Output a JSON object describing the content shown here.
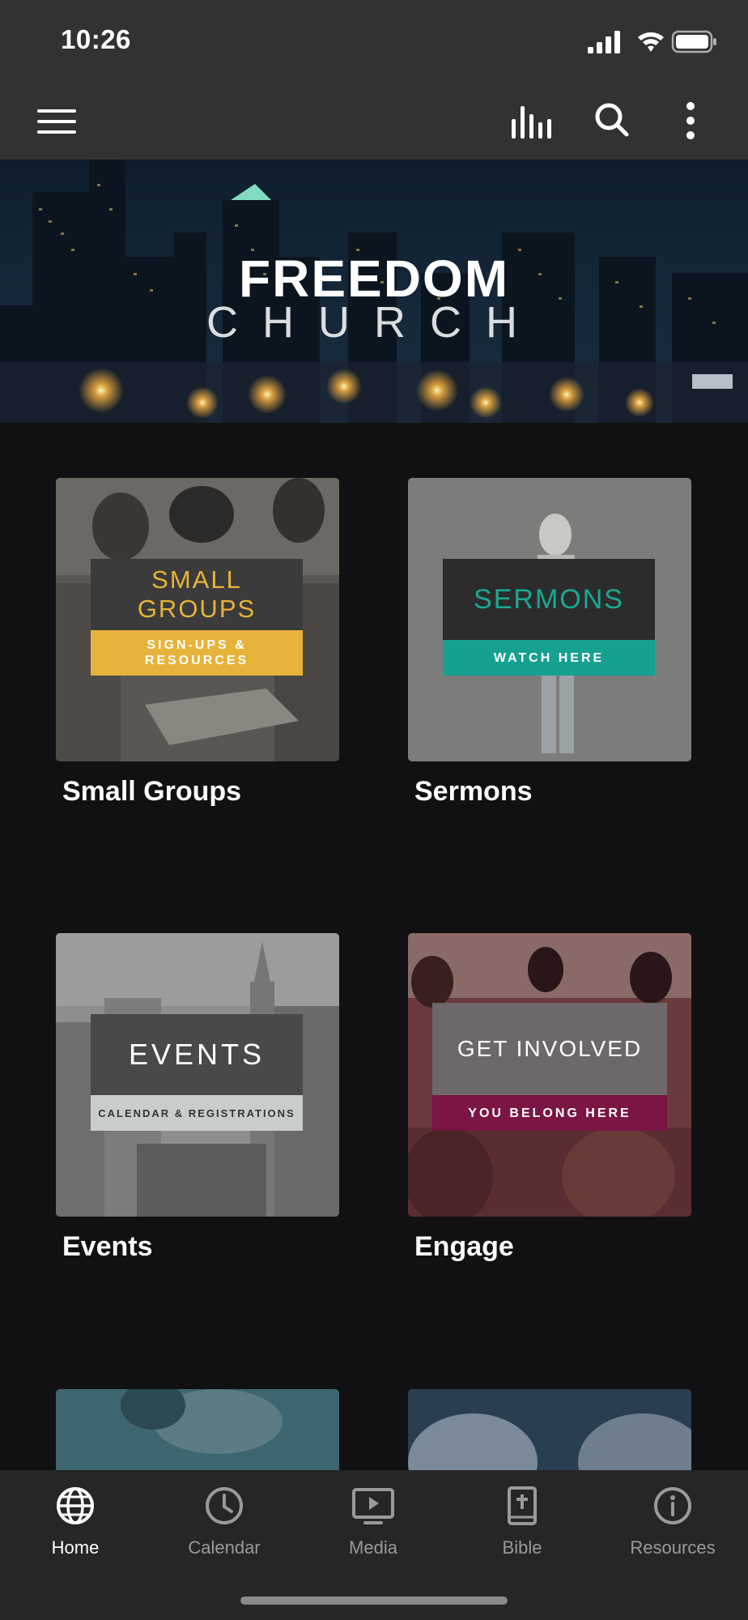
{
  "status_bar": {
    "time": "10:26"
  },
  "header": {
    "menu_icon": "hamburger-menu-icon",
    "actions": [
      "equalizer-icon",
      "search-icon",
      "more-vertical-icon"
    ]
  },
  "hero": {
    "logo_line1": "FREEDOM",
    "logo_line2": "CHURCH"
  },
  "cards": [
    {
      "title": "Small Groups",
      "banner_heading": "SMALL GROUPS",
      "banner_subtitle": "SIGN-UPS & RESOURCES",
      "accent": "#e8b33a"
    },
    {
      "title": "Sermons",
      "banner_heading": "SERMONS",
      "banner_subtitle": "WATCH HERE",
      "accent": "#16a090"
    },
    {
      "title": "Events",
      "banner_heading": "EVENTS",
      "banner_subtitle": "CALENDAR & REGISTRATIONS",
      "accent": "#c9cdc9"
    },
    {
      "title": "Engage",
      "banner_heading": "GET INVOLVED",
      "banner_subtitle": "YOU BELONG HERE",
      "accent": "#7a1544"
    }
  ],
  "bottom_nav": {
    "items": [
      {
        "label": "Home",
        "icon": "globe-icon",
        "active": true
      },
      {
        "label": "Calendar",
        "icon": "clock-icon",
        "active": false
      },
      {
        "label": "Media",
        "icon": "play-screen-icon",
        "active": false
      },
      {
        "label": "Bible",
        "icon": "bible-icon",
        "active": false
      },
      {
        "label": "Resources",
        "icon": "info-icon",
        "active": false
      }
    ]
  },
  "colors": {
    "bar_bg": "#323232",
    "page_bg": "#111113",
    "nav_bg": "#262626",
    "nav_inactive": "#9a9a9a"
  }
}
